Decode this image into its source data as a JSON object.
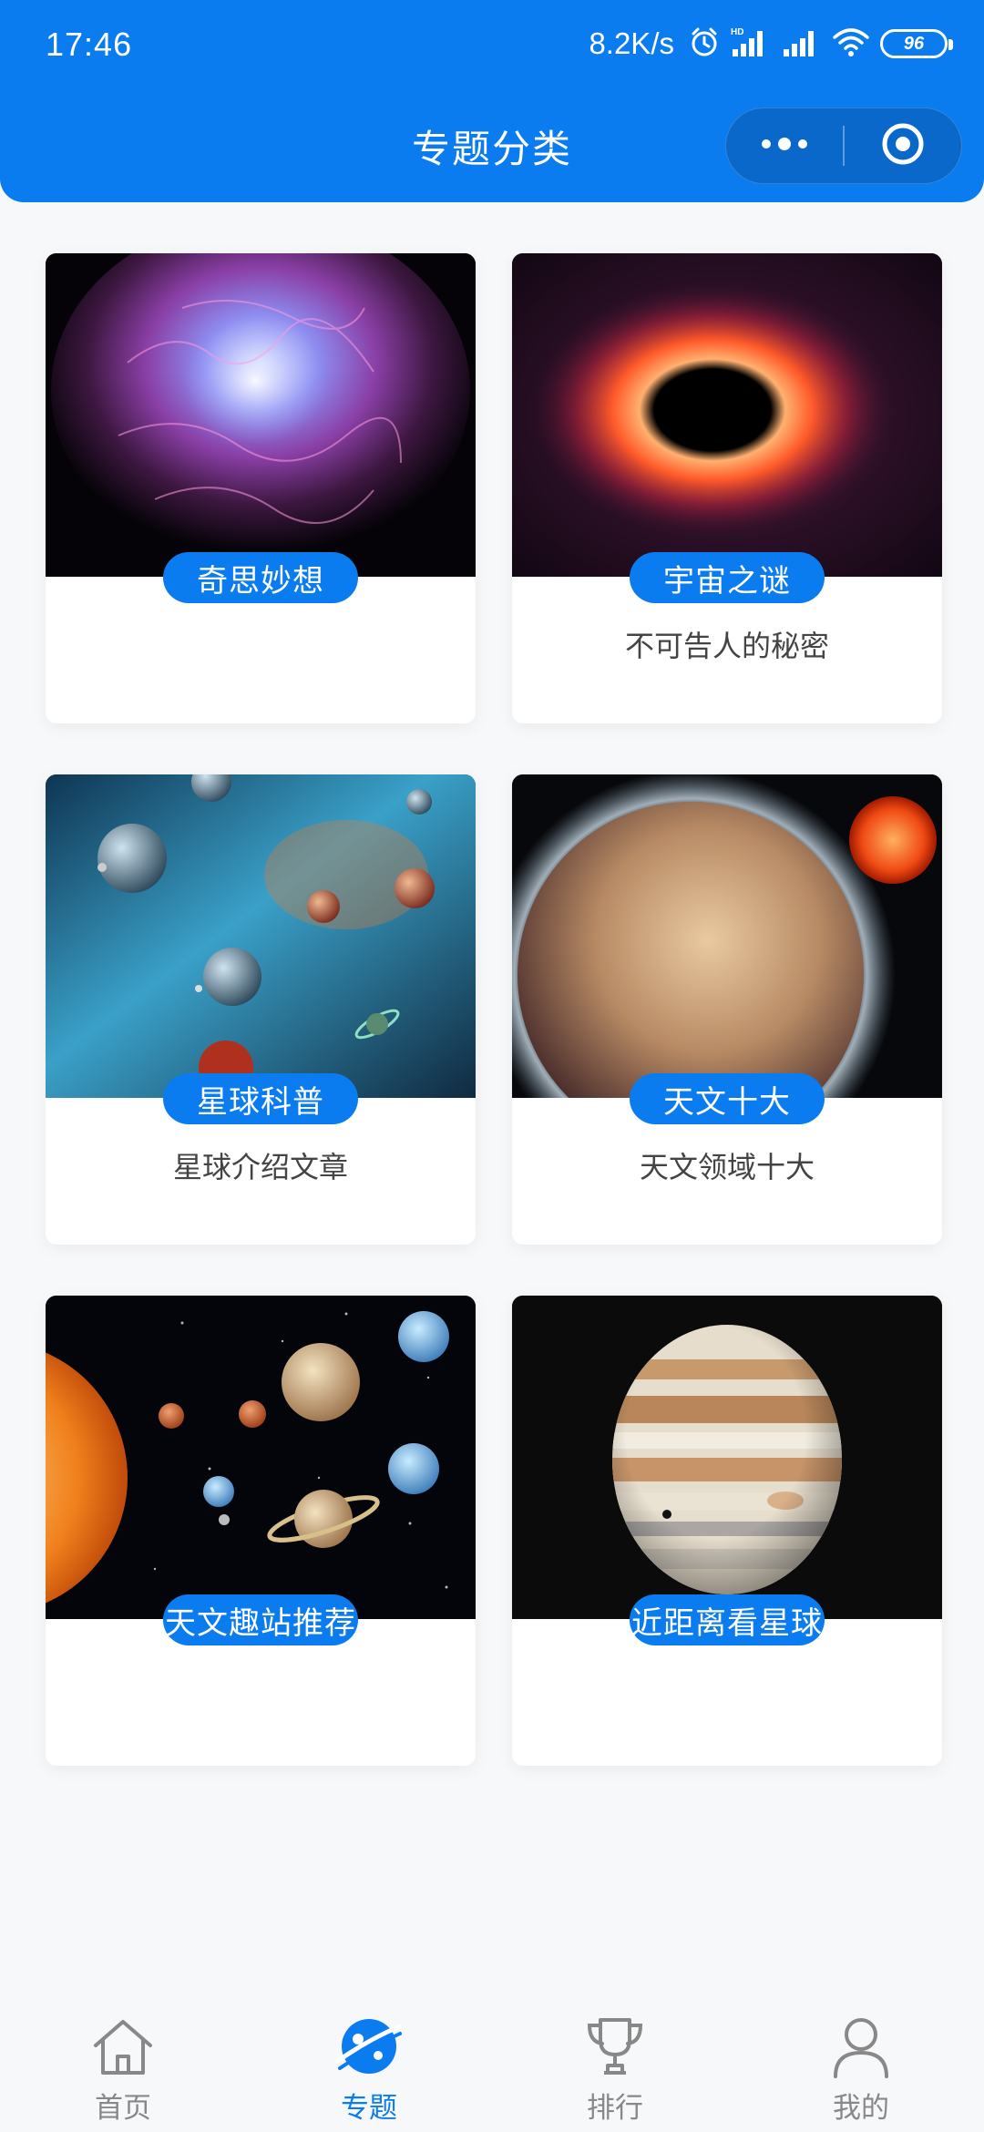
{
  "status_bar": {
    "time": "17:46",
    "net_speed": "8.2K/s",
    "battery": "96"
  },
  "header": {
    "title": "专题分类"
  },
  "categories": [
    {
      "tag": "奇思妙想",
      "desc": "",
      "image_icon": "nebula-image"
    },
    {
      "tag": "宇宙之谜",
      "desc": "不可告人的秘密",
      "image_icon": "black-hole-image"
    },
    {
      "tag": "星球科普",
      "desc": "星球介绍文章",
      "image_icon": "planets-nebula-image"
    },
    {
      "tag": "天文十大",
      "desc": "天文领域十大",
      "image_icon": "exoplanet-image"
    },
    {
      "tag": "天文趣站推荐",
      "desc": "",
      "image_icon": "solar-system-image"
    },
    {
      "tag": "近距离看星球",
      "desc": "",
      "image_icon": "jupiter-image"
    }
  ],
  "tabbar": {
    "items": [
      {
        "label": "首页",
        "icon": "home-icon"
      },
      {
        "label": "专题",
        "icon": "planet-icon"
      },
      {
        "label": "排行",
        "icon": "trophy-icon"
      },
      {
        "label": "我的",
        "icon": "user-icon"
      }
    ],
    "active_index": 1
  },
  "colors": {
    "accent": "#0b7cf0",
    "background": "#f7f8fa",
    "inactive": "#888888"
  }
}
